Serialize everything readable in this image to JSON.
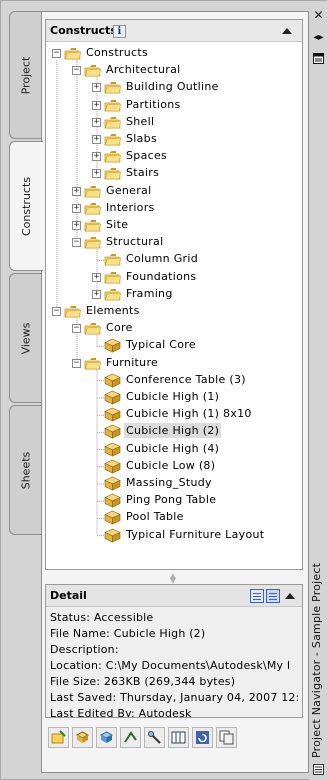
{
  "palette": {
    "folder": "#f3d35b",
    "folder_dark": "#c89a22",
    "cube_top": "#f6d67a",
    "cube_side": "#c8951e",
    "cube_front": "#e0b33a",
    "selection": "#dcdcdc"
  },
  "window": {
    "title": "Project Navigator - Sample Project",
    "close_icon": "close-icon",
    "pin_icon": "pin-icon",
    "menu_icon": "properties-menu-icon"
  },
  "tabs": [
    {
      "label": "Project",
      "active": false
    },
    {
      "label": "Constructs",
      "active": true
    },
    {
      "label": "Views",
      "active": false
    },
    {
      "label": "Sheets",
      "active": false
    }
  ],
  "tree": {
    "header": "Constructs",
    "info_badge": "i",
    "nodes": [
      {
        "label": "Constructs",
        "depth": 0,
        "icon": "folder",
        "expander": "−"
      },
      {
        "label": "Architectural",
        "depth": 1,
        "icon": "folder",
        "expander": "−"
      },
      {
        "label": "Building Outline",
        "depth": 2,
        "icon": "folder",
        "expander": "+"
      },
      {
        "label": "Partitions",
        "depth": 2,
        "icon": "folder",
        "expander": "+"
      },
      {
        "label": "Shell",
        "depth": 2,
        "icon": "folder",
        "expander": "+"
      },
      {
        "label": "Slabs",
        "depth": 2,
        "icon": "folder",
        "expander": "+"
      },
      {
        "label": "Spaces",
        "depth": 2,
        "icon": "folder",
        "expander": "+"
      },
      {
        "label": "Stairs",
        "depth": 2,
        "icon": "folder",
        "expander": "+"
      },
      {
        "label": "General",
        "depth": 1,
        "icon": "folder",
        "expander": "+"
      },
      {
        "label": "Interiors",
        "depth": 1,
        "icon": "folder",
        "expander": "+"
      },
      {
        "label": "Site",
        "depth": 1,
        "icon": "folder",
        "expander": "+"
      },
      {
        "label": "Structural",
        "depth": 1,
        "icon": "folder",
        "expander": "−"
      },
      {
        "label": "Column Grid",
        "depth": 2,
        "icon": "folder",
        "expander": ""
      },
      {
        "label": "Foundations",
        "depth": 2,
        "icon": "folder",
        "expander": "+"
      },
      {
        "label": "Framing",
        "depth": 2,
        "icon": "folder",
        "expander": "+"
      },
      {
        "label": "Elements",
        "depth": 0,
        "icon": "folder",
        "expander": "−"
      },
      {
        "label": "Core",
        "depth": 1,
        "icon": "folder",
        "expander": "−"
      },
      {
        "label": "Typical Core",
        "depth": 2,
        "icon": "cube",
        "expander": ""
      },
      {
        "label": "Furniture",
        "depth": 1,
        "icon": "folder",
        "expander": "−"
      },
      {
        "label": "Conference Table (3)",
        "depth": 2,
        "icon": "cube",
        "expander": ""
      },
      {
        "label": "Cubicle High (1)",
        "depth": 2,
        "icon": "cube",
        "expander": ""
      },
      {
        "label": "Cubicle High (1) 8x10",
        "depth": 2,
        "icon": "cube",
        "expander": ""
      },
      {
        "label": "Cubicle High (2)",
        "depth": 2,
        "icon": "cube",
        "expander": "",
        "selected": true
      },
      {
        "label": "Cubicle High (4)",
        "depth": 2,
        "icon": "cube",
        "expander": ""
      },
      {
        "label": "Cubicle Low (8)",
        "depth": 2,
        "icon": "cube",
        "expander": ""
      },
      {
        "label": "Massing_Study",
        "depth": 2,
        "icon": "cube",
        "expander": ""
      },
      {
        "label": "Ping Pong Table",
        "depth": 2,
        "icon": "cube",
        "expander": ""
      },
      {
        "label": "Pool Table",
        "depth": 2,
        "icon": "cube",
        "expander": ""
      },
      {
        "label": "Typical Furniture Layout",
        "depth": 2,
        "icon": "cube",
        "expander": ""
      }
    ]
  },
  "detail": {
    "title": "Detail",
    "lines": [
      "Status: Accessible",
      "File Name: Cubicle High (2)",
      "Description:",
      "Location: C:\\My Documents\\Autodesk\\My I",
      "File Size: 263KB (269,344 bytes)",
      "Last Saved: Thursday, January 04, 2007  12:",
      "Last Edited By: Autodesk"
    ]
  },
  "toolbar": {
    "buttons": [
      "add-category-icon",
      "add-element-icon",
      "add-construct-icon",
      "repath-icon",
      "configure-icon",
      "external-references-icon",
      "refresh-icon",
      "copy-icon"
    ]
  }
}
